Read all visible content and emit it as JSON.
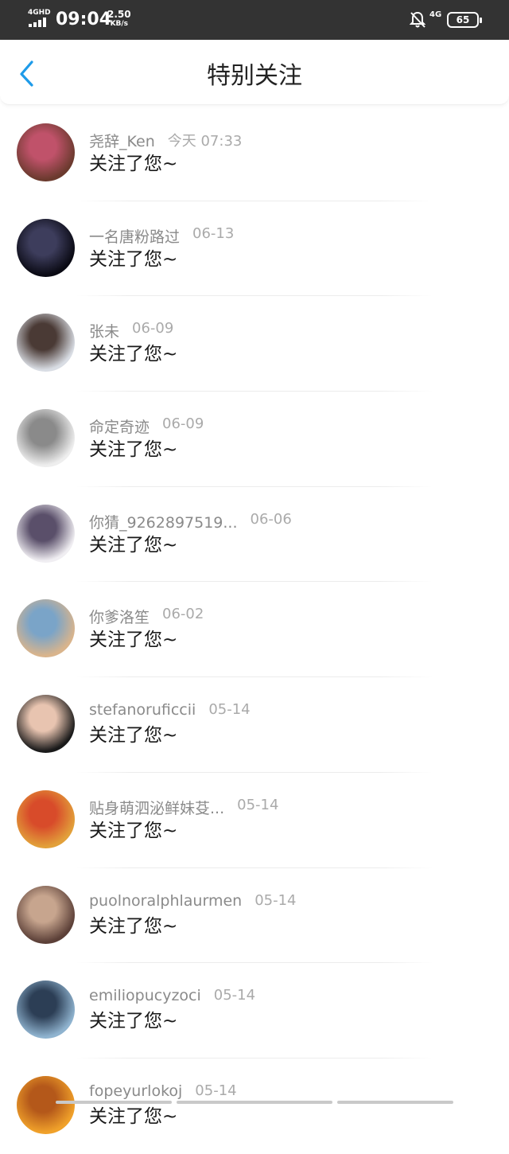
{
  "status_bar": {
    "network": "4GHD",
    "time": "09:04",
    "speed_value": "2.50",
    "speed_unit": "KB/s",
    "signal": "4G",
    "battery": "65"
  },
  "header": {
    "title": "特别关注",
    "back_icon": "chevron-left-icon",
    "accent": "#1E9BE9"
  },
  "items": [
    {
      "name": "尧辞_Ken",
      "date": "今天 07:33",
      "action": "关注了您~",
      "avatar_colors": [
        "#6b3a2e",
        "#c0526a"
      ]
    },
    {
      "name": "一名唐粉路过",
      "date": "06-13",
      "action": "关注了您~",
      "avatar_colors": [
        "#0a0a14",
        "#3d3d5c"
      ]
    },
    {
      "name": "张未",
      "date": "06-09",
      "action": "关注了您~",
      "avatar_colors": [
        "#d9dde4",
        "#4a3a35"
      ]
    },
    {
      "name": "命定奇迹",
      "date": "06-09",
      "action": "关注了您~",
      "avatar_colors": [
        "#eeeeee",
        "#8a8a8a"
      ]
    },
    {
      "name": "你猜_9262897519...",
      "date": "06-06",
      "action": "关注了您~",
      "avatar_colors": [
        "#f0eef2",
        "#5a4f6a"
      ]
    },
    {
      "name": "你爹洛笙",
      "date": "06-02",
      "action": "关注了您~",
      "avatar_colors": [
        "#d9b48c",
        "#7aa4c8"
      ]
    },
    {
      "name": "stefanoruficcii",
      "date": "05-14",
      "action": "关注了您~",
      "avatar_colors": [
        "#1a1a1a",
        "#e8c4b0"
      ]
    },
    {
      "name": "贴身萌泗泌鲜妹芟...",
      "date": "05-14",
      "action": "关注了您~",
      "avatar_colors": [
        "#e2a03a",
        "#d84b2a"
      ]
    },
    {
      "name": "puolnoralphlaurmen",
      "date": "05-14",
      "action": "关注了您~",
      "avatar_colors": [
        "#5c4038",
        "#c7a58e"
      ]
    },
    {
      "name": "emiliopucyzoci",
      "date": "05-14",
      "action": "关注了您~",
      "avatar_colors": [
        "#8fb3cf",
        "#2c3e55"
      ]
    },
    {
      "name": "fopeyurlokoj",
      "date": "05-14",
      "action": "关注了您~",
      "avatar_colors": [
        "#f0a12a",
        "#b4581a"
      ]
    }
  ]
}
